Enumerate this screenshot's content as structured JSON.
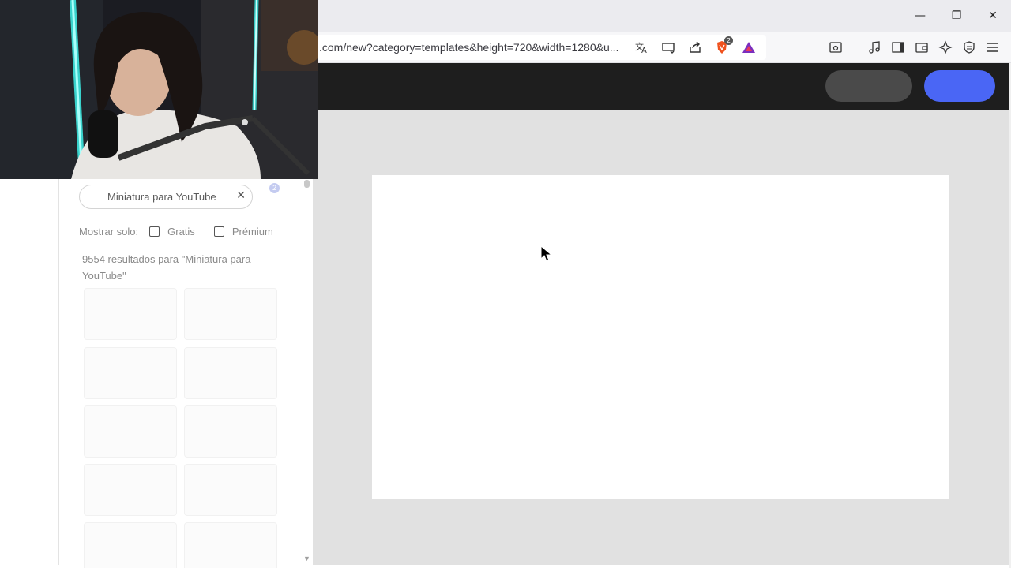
{
  "browser": {
    "url": ".com/new?category=templates&height=720&width=1280&u...",
    "shields_badge": "2",
    "icons": [
      "translate-icon",
      "cast-icon",
      "share-icon",
      "brave-shields-icon",
      "brave-rewards-icon",
      "leo-icon",
      "music-icon",
      "sidebar-icon",
      "wallet-icon",
      "ai-icon",
      "vpn-icon",
      "menu-icon"
    ],
    "window_controls": {
      "minimize": "—",
      "restore": "❐",
      "close": "✕"
    }
  },
  "panel": {
    "search_value": "Miniatura para YouTube",
    "badge": "2",
    "filter_label": "Mostrar solo:",
    "filter_free": "Gratis",
    "filter_premium": "Prémium",
    "results_text": "9554 resultados para \"Miniatura para YouTube\""
  },
  "colors": {
    "header_bg": "#1e1e1e",
    "primary_button": "#4a66f5",
    "secondary_button": "#4a4a4a",
    "workspace_bg": "#e1e1e1"
  }
}
